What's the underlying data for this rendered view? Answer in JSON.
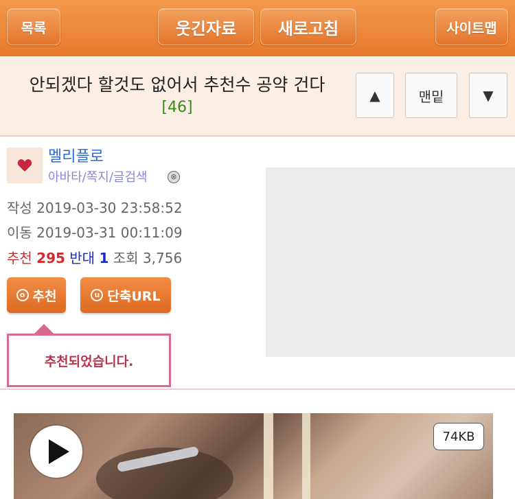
{
  "topbar": {
    "list_label": "목록",
    "humor_label": "웃긴자료",
    "refresh_label": "새로고침",
    "sitemap_label": "사이트맵"
  },
  "post": {
    "title": "안되겠다 할것도 없어서 추천수 공약 건다",
    "comment_count": "[46]"
  },
  "nav": {
    "up_label": "▲",
    "bottom_label": "맨밑",
    "down_label": "▼"
  },
  "author": {
    "name": "멜리플로",
    "links": "아바타/쪽지/글검색",
    "avatar_icon": "heart-icon"
  },
  "meta": {
    "write_label": "작성",
    "write_time": "2019-03-30 23:58:52",
    "move_label": "이동",
    "move_time": "2019-03-31 00:11:09",
    "recommend_label": "추천",
    "recommend_count": "295",
    "oppose_label": "반대",
    "oppose_count": "1",
    "views_label": "조회",
    "views_count": "3,756"
  },
  "actions": {
    "recommend_icon_glyph": "⓪",
    "recommend_label": "추천",
    "url_icon_glyph": "u",
    "url_label": "단축URL"
  },
  "tooltip": {
    "message": "추천되었습니다."
  },
  "media": {
    "size_label": "74KB"
  },
  "colors": {
    "accent": "#e8792a",
    "recommend": "#d32a2a",
    "oppose": "#1a2ac6",
    "author": "#2a6ad6",
    "count": "#3a8a1a"
  }
}
